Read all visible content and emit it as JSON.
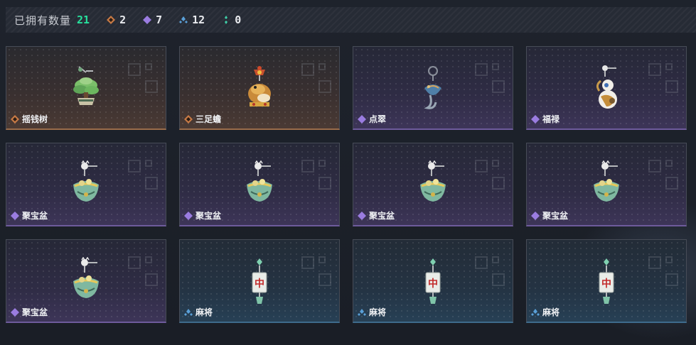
{
  "header": {
    "title": "已拥有数量",
    "total": "21",
    "stats": [
      {
        "icon": "orange-rarity-icon",
        "count": "2",
        "color": "#c87a45"
      },
      {
        "icon": "purple-rarity-icon",
        "count": "7",
        "color": "#9a7ce0"
      },
      {
        "icon": "blue-rarity-icon",
        "count": "12",
        "color": "#5aa0d8"
      },
      {
        "icon": "green-rarity-icon",
        "count": "0",
        "color": "#3fd0a8"
      }
    ]
  },
  "colors": {
    "orange": "#c87a45",
    "purple": "#9a7ce0",
    "blue": "#5aa0d8",
    "accent_green": "#27e19d"
  },
  "items": [
    {
      "name": "摇钱树",
      "rarity": "orange",
      "icon": "money-tree-pendant-icon"
    },
    {
      "name": "三足蟾",
      "rarity": "orange",
      "icon": "three-legged-toad-pendant-icon"
    },
    {
      "name": "点翠",
      "rarity": "purple",
      "icon": "kingfisher-pendant-icon"
    },
    {
      "name": "福禄",
      "rarity": "purple",
      "icon": "gourd-pendant-icon"
    },
    {
      "name": "聚宝盆",
      "rarity": "purple",
      "icon": "treasure-bowl-pendant-icon"
    },
    {
      "name": "聚宝盆",
      "rarity": "purple",
      "icon": "treasure-bowl-pendant-icon"
    },
    {
      "name": "聚宝盆",
      "rarity": "purple",
      "icon": "treasure-bowl-pendant-icon"
    },
    {
      "name": "聚宝盆",
      "rarity": "purple",
      "icon": "treasure-bowl-pendant-icon"
    },
    {
      "name": "聚宝盆",
      "rarity": "purple",
      "icon": "treasure-bowl-pendant-icon"
    },
    {
      "name": "麻将",
      "rarity": "blue",
      "icon": "mahjong-tile-pendant-icon"
    },
    {
      "name": "麻将",
      "rarity": "blue",
      "icon": "mahjong-tile-pendant-icon"
    },
    {
      "name": "麻将",
      "rarity": "blue",
      "icon": "mahjong-tile-pendant-icon"
    }
  ],
  "mahjong_tile_glyph": "中"
}
